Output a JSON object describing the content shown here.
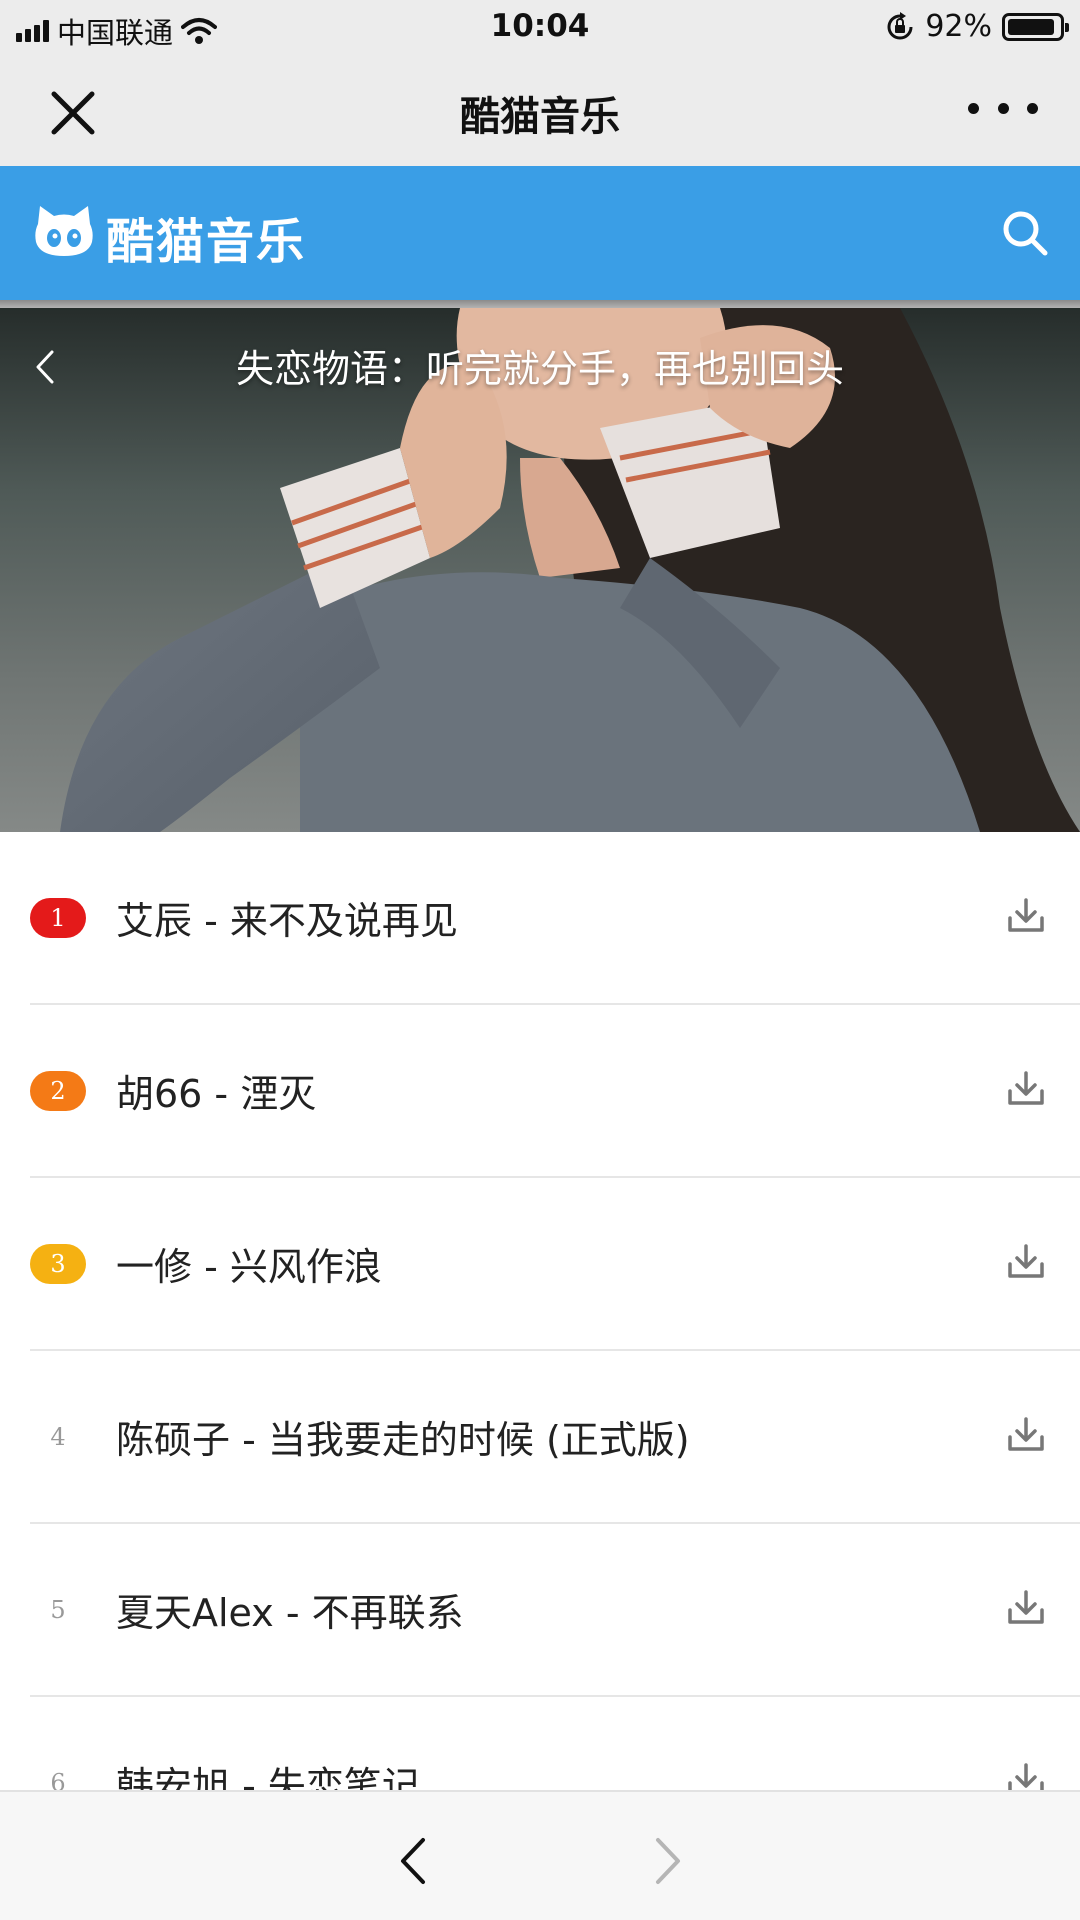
{
  "status_bar": {
    "carrier": "中国联通",
    "time": "10:04",
    "battery_percent": "92%",
    "battery_level": 0.92,
    "icons": [
      "signal-icon",
      "wifi-icon",
      "rotation-lock-icon",
      "battery-icon"
    ]
  },
  "wechat_bar": {
    "title": "酷猫音乐",
    "icons": [
      "close-icon",
      "more-icon"
    ]
  },
  "app_header": {
    "title": "酷猫音乐",
    "icons": [
      "cat-logo-icon",
      "search-icon"
    ],
    "color": "#3a9ee6"
  },
  "banner": {
    "title": "失恋物语：听完就分手，再也别回头",
    "icons": [
      "back-chevron-icon"
    ]
  },
  "songs": [
    {
      "rank": "1",
      "title": "艾辰 - 来不及说再见",
      "badge_color": "#e41a1a"
    },
    {
      "rank": "2",
      "title": "胡66 - 湮灭",
      "badge_color": "#f47a16"
    },
    {
      "rank": "3",
      "title": "一修 - 兴风作浪",
      "badge_color": "#f5b112"
    },
    {
      "rank": "4",
      "title": "陈硕子 - 当我要走的时候 (正式版)"
    },
    {
      "rank": "5",
      "title": "夏天Alex - 不再联系"
    },
    {
      "rank": "6",
      "title": "韩安旭 - 失恋笔记"
    }
  ],
  "bottom_nav": {
    "icons": [
      "nav-back-icon",
      "nav-forward-icon"
    ]
  }
}
